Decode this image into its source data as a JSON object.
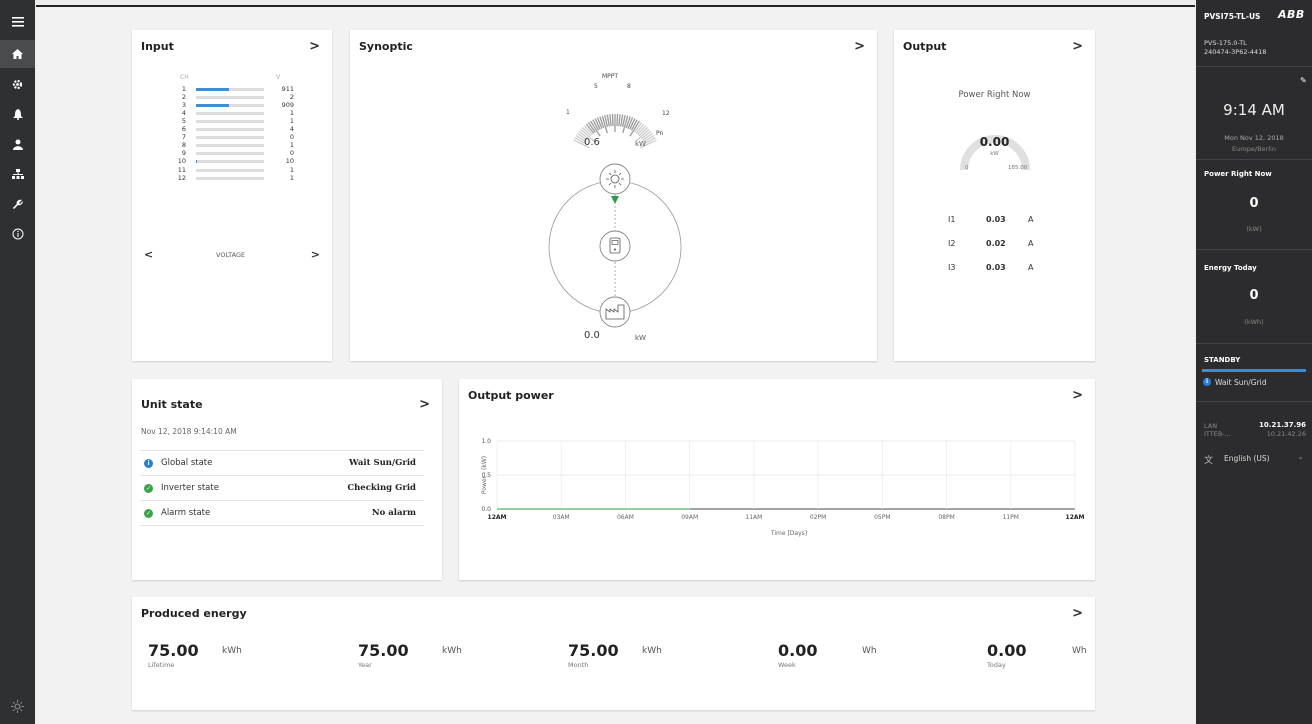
{
  "device": {
    "name": "PVSI75-TL-US",
    "brand": "ABB",
    "model": "PVS-175.0-TL",
    "serial": "240474-3P62-4418"
  },
  "clock": {
    "time": "9:14 AM",
    "date": "Mon Nov 12, 2018",
    "timezone": "Europe/Berlin"
  },
  "side_power": {
    "label": "Power Right Now",
    "value": "0",
    "unit": "(kW)"
  },
  "side_energy": {
    "label": "Energy Today",
    "value": "0",
    "unit": "(kWh)"
  },
  "side_status": {
    "label": "STANDBY",
    "message": "Wait Sun/Grid"
  },
  "network": {
    "lan_label": "LAN",
    "lan_ip": "10.21.37.96",
    "wlan_label": "ITTEB-...",
    "wlan_ip": "10.21.42.26"
  },
  "language": "English (US)",
  "input": {
    "title": "Input",
    "col_ch": "CH",
    "col_v": "V",
    "footer": "VOLTAGE",
    "channels": [
      {
        "ch": "1",
        "v": "911",
        "fill": 0.49
      },
      {
        "ch": "2",
        "v": "2",
        "fill": 0
      },
      {
        "ch": "3",
        "v": "909",
        "fill": 0.49
      },
      {
        "ch": "4",
        "v": "1",
        "fill": 0
      },
      {
        "ch": "5",
        "v": "1",
        "fill": 0
      },
      {
        "ch": "6",
        "v": "4",
        "fill": 0
      },
      {
        "ch": "7",
        "v": "0",
        "fill": 0
      },
      {
        "ch": "8",
        "v": "1",
        "fill": 0
      },
      {
        "ch": "9",
        "v": "0",
        "fill": 0
      },
      {
        "ch": "10",
        "v": "10",
        "fill": 0.02
      },
      {
        "ch": "11",
        "v": "1",
        "fill": 0
      },
      {
        "ch": "12",
        "v": "1",
        "fill": 0
      }
    ]
  },
  "synoptic": {
    "title": "Synoptic",
    "mppt_label": "MPPT",
    "gauge_ticks": [
      "1",
      "5",
      "8",
      "12",
      "Pn"
    ],
    "pv_value": "0.6",
    "pv_unit": "kW",
    "grid_value": "0.0",
    "grid_unit": "kW"
  },
  "output": {
    "title": "Output",
    "gauge_label": "Power Right Now",
    "gauge_value": "0.00",
    "gauge_unit": "kW",
    "gauge_min": "0",
    "gauge_max": "185.00",
    "phases": [
      {
        "name": "I1",
        "value": "0.03",
        "unit": "A"
      },
      {
        "name": "I2",
        "value": "0.02",
        "unit": "A"
      },
      {
        "name": "I3",
        "value": "0.03",
        "unit": "A"
      }
    ]
  },
  "unit_state": {
    "title": "Unit state",
    "timestamp": "Nov 12, 2018 9:14:10 AM",
    "rows": [
      {
        "label": "Global state",
        "value": "Wait Sun/Grid",
        "color": "#2a7dd4",
        "icon": "i"
      },
      {
        "label": "Inverter state",
        "value": "Checking Grid",
        "color": "#3aa24b",
        "icon": "✓"
      },
      {
        "label": "Alarm state",
        "value": "No alarm",
        "color": "#3aa24b",
        "icon": "✓"
      }
    ]
  },
  "output_power": {
    "title": "Output power",
    "chart_data": {
      "type": "line",
      "x": [
        "12AM",
        "03AM",
        "06AM",
        "09AM",
        "11AM",
        "02PM",
        "05PM",
        "08PM",
        "11PM",
        "12AM"
      ],
      "series": [
        {
          "values": [
            0,
            0,
            0,
            0
          ]
        }
      ],
      "ylabel": "Power - (kW)",
      "xlabel": "Time [Days]",
      "yticks": [
        "1.0",
        "0.5",
        "0.0"
      ],
      "ylim": [
        0,
        1.0
      ],
      "grid": true
    }
  },
  "produced_energy": {
    "title": "Produced energy",
    "items": [
      {
        "value": "75.00",
        "unit": "kWh",
        "label": "Lifetime"
      },
      {
        "value": "75.00",
        "unit": "kWh",
        "label": "Year"
      },
      {
        "value": "75.00",
        "unit": "kWh",
        "label": "Month"
      },
      {
        "value": "0.00",
        "unit": "Wh",
        "label": "Week"
      },
      {
        "value": "0.00",
        "unit": "Wh",
        "label": "Today"
      }
    ]
  },
  "arrow": ">",
  "arrow_left": "<",
  "colors": {
    "accent": "#3d8fd4",
    "green": "#3aa24b",
    "dark": "#2c2c2e"
  }
}
